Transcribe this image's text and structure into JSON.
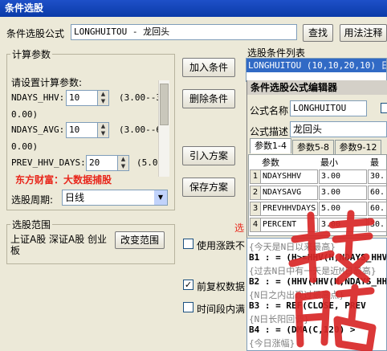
{
  "window": {
    "title": "条件选股"
  },
  "formula": {
    "label": "条件选股公式",
    "value": "LONGHUITOU  - 龙回头",
    "find_btn": "查找",
    "usage_btn": "用法注释"
  },
  "calc_params": {
    "group_title": "计算参数",
    "prompt": "请设置计算参数:",
    "rows": [
      {
        "name": "NDAYS_HHV:",
        "value": "10",
        "range_a": "(3.00--3",
        "range_b": "0.00)"
      },
      {
        "name": "NDAYS_AVG:",
        "value": "10",
        "range_a": "(3.00--6",
        "range_b": "0.00)"
      },
      {
        "name": "PREV_HHV_DAYS:",
        "value": "20",
        "range_a": "(5.0"
      }
    ],
    "watermark": "东方财富：大数据捕股",
    "period_label": "选股周期:",
    "period_value": "日线"
  },
  "range": {
    "group_title": "选股范围",
    "text": "上证A股 深证A股 创业板",
    "change_btn": "改变范围"
  },
  "actions": {
    "add": "加入条件",
    "delete": "删除条件",
    "import": "引入方案",
    "save": "保存方案"
  },
  "cond_list": {
    "label": "选股条件列表",
    "item": "LONGHUITOU (10,10,20,10) 日线"
  },
  "options": {
    "limit_label": "使用涨跌不",
    "forward_label": "前复权数据",
    "timerange_label": "时间段内满",
    "red_text": "选",
    "limit_checked": false,
    "forward_checked": true,
    "timerange_checked": false
  },
  "editor": {
    "title": "条件选股公式编辑器",
    "name_label": "公式名称",
    "name_value": "LONGHUITOU",
    "desc_label": "公式描述",
    "desc_value": "龙回头",
    "tabs": [
      "参数1-4",
      "参数5-8",
      "参数9-12"
    ],
    "headers": [
      "参数",
      "最小",
      "最大"
    ],
    "params": [
      {
        "num": "1",
        "name": "NDAYSHHV",
        "min": "3.00",
        "max": "30."
      },
      {
        "num": "2",
        "name": "NDAYSAVG",
        "min": "3.00",
        "max": "60."
      },
      {
        "num": "3",
        "name": "PREVHHVDAYS",
        "min": "5.00",
        "max": "60."
      },
      {
        "num": "4",
        "name": "PERCENT",
        "min": "3.00",
        "max": "30."
      }
    ],
    "code": [
      {
        "text": "{今天是N日以来最高}",
        "kind": "comment"
      },
      {
        "text": "B1 : = (H>=HHV(H,NDAYS_HHV(CL",
        "kind": "bold"
      },
      {
        "text": "{过去N日中有一天是近M日最高}",
        "kind": "comment"
      },
      {
        "text": "B2 : = (HHV(HHV(H,NDAYS_HHV",
        "kind": "bold"
      },
      {
        "text": "{N日之内出现过最高点}",
        "kind": "comment"
      },
      {
        "text": "B3 : = REF(CLOSE, PREV",
        "kind": "bold"
      },
      {
        "text": "{N日长阳回调}",
        "kind": "comment"
      },
      {
        "text": "B4 : = (DMA(C,120) >",
        "kind": "bold"
      },
      {
        "text": "{今日涨幅}",
        "kind": "comment"
      }
    ]
  },
  "colors": {
    "title_bar": "#0a3aa8",
    "selection": "#316ac5",
    "watermark": "#e8261b",
    "stamp": "#d92828"
  }
}
